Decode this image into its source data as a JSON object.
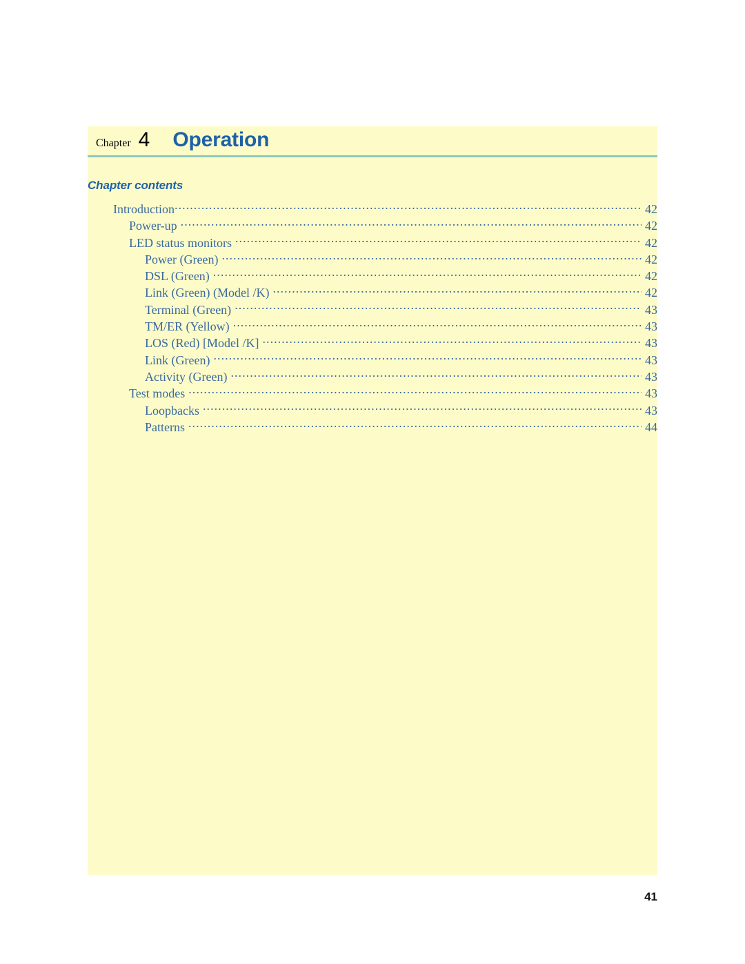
{
  "page": {
    "background_color": "#ffffff",
    "panel_color": "#fdfcc9",
    "accent_color": "#1d62a8",
    "rule_color": "#8fc7bd",
    "toc_text_color": "#39699f",
    "folio": "41"
  },
  "header": {
    "chapter_label": "Chapter",
    "chapter_number": "4",
    "chapter_name": "Operation"
  },
  "contents": {
    "heading": "Chapter contents",
    "entries": [
      {
        "title": "Introduction",
        "page": "42",
        "level": 1,
        "gap": false
      },
      {
        "title": "Power-up",
        "page": "42",
        "level": 2,
        "gap": true
      },
      {
        "title": "LED status monitors",
        "page": "42",
        "level": 2,
        "gap": true
      },
      {
        "title": "Power (Green)",
        "page": "42",
        "level": 3,
        "gap": true
      },
      {
        "title": "DSL (Green)",
        "page": "42",
        "level": 3,
        "gap": true
      },
      {
        "title": "Link (Green) (Model /K)",
        "page": "42",
        "level": 3,
        "gap": true
      },
      {
        "title": "Terminal (Green)",
        "page": "43",
        "level": 3,
        "gap": true
      },
      {
        "title": "TM/ER (Yellow)",
        "page": "43",
        "level": 3,
        "gap": true
      },
      {
        "title": "LOS (Red) [Model /K]",
        "page": "43",
        "level": 3,
        "gap": true
      },
      {
        "title": "Link (Green)",
        "page": "43",
        "level": 3,
        "gap": true
      },
      {
        "title": "Activity (Green)",
        "page": "43",
        "level": 3,
        "gap": true
      },
      {
        "title": "Test modes",
        "page": "43",
        "level": 2,
        "gap": true
      },
      {
        "title": "Loopbacks",
        "page": "43",
        "level": 3,
        "gap": true
      },
      {
        "title": "Patterns",
        "page": "44",
        "level": 3,
        "gap": true
      }
    ]
  }
}
